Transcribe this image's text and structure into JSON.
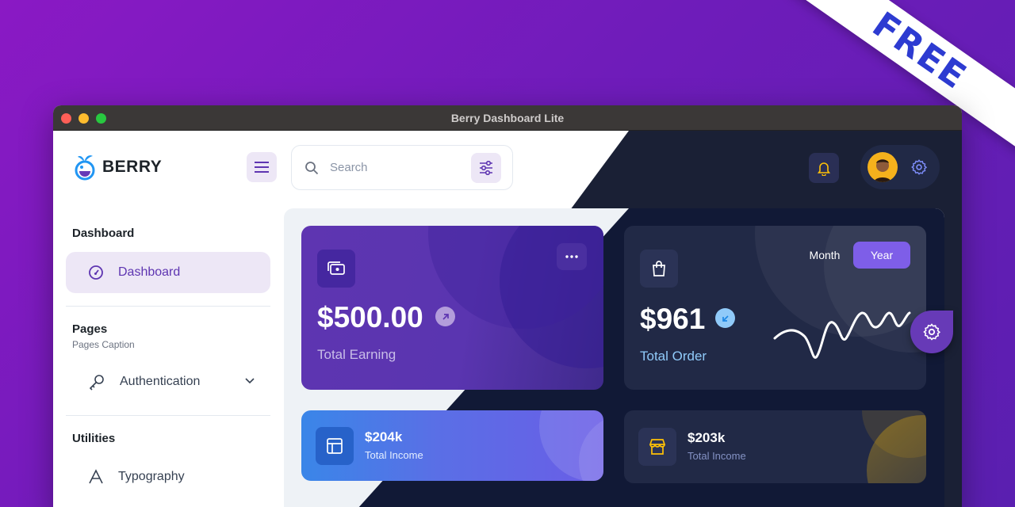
{
  "ribbon": "FREE",
  "window": {
    "title": "Berry Dashboard Lite"
  },
  "brand": "BERRY",
  "search": {
    "placeholder": "Search"
  },
  "sidebar": {
    "groups": [
      {
        "title": "Dashboard",
        "items": [
          {
            "label": "Dashboard",
            "icon": "dashboard-icon",
            "active": true
          }
        ]
      },
      {
        "title": "Pages",
        "caption": "Pages Caption",
        "items": [
          {
            "label": "Authentication",
            "icon": "key-icon"
          }
        ]
      },
      {
        "title": "Utilities",
        "items": [
          {
            "label": "Typography",
            "icon": "typography-icon"
          }
        ]
      }
    ]
  },
  "cards": {
    "earning": {
      "value": "$500.00",
      "label": "Total Earning"
    },
    "order": {
      "value": "$961",
      "label": "Total Order",
      "toggle": [
        "Month",
        "Year"
      ],
      "selected": "Year"
    },
    "income_blue": {
      "value": "$204k",
      "label": "Total Income"
    },
    "income_dark": {
      "value": "$203k",
      "label": "Total Income"
    }
  },
  "colors": {
    "primary": "#673ab7",
    "secondary": "#5e35b1",
    "blue": "#2196f3",
    "dark_bg": "#1a2035",
    "warning": "#ffc107"
  }
}
